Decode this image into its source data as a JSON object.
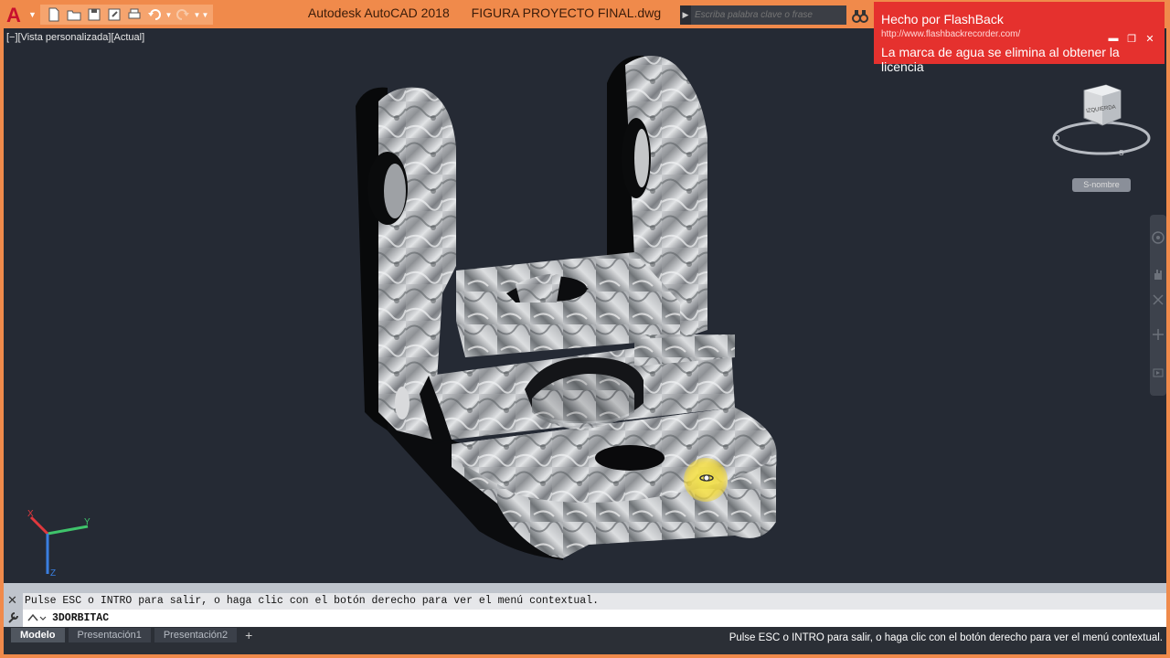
{
  "window": {
    "app_name": "Autodesk AutoCAD 2018",
    "file_name": "FIGURA PROYECTO FINAL.dwg"
  },
  "search": {
    "placeholder": "Escriba palabra clave o frase"
  },
  "watermark": {
    "title": "Hecho por FlashBack",
    "url": "http://www.flashbackrecorder.com/",
    "text": "La marca de agua se elimina al obtener la licencia"
  },
  "viewport": {
    "label": "[−][Vista personalizada][Actual]",
    "wcs_label": "S-nombre",
    "viewcube_face": "IZQUIERDA",
    "viewcube_compass": {
      "west": "O",
      "south": "S"
    },
    "ucs": {
      "x": "X",
      "y": "Y",
      "z": "Z"
    }
  },
  "command": {
    "history": "Pulse ESC o INTRO para salir, o haga clic con el botón derecho para ver el menú contextual.",
    "current": "3DORBITAC"
  },
  "layout_tabs": [
    {
      "label": "Modelo",
      "active": true
    },
    {
      "label": "Presentación1",
      "active": false
    },
    {
      "label": "Presentación2",
      "active": false
    }
  ],
  "status": {
    "message": "Pulse ESC o INTRO para salir, o haga clic con el botón derecho para ver el menú contextual."
  },
  "colors": {
    "titlebar": "#f08a4b",
    "viewport_bg": "#252a34",
    "watermark_bg": "#e5312e",
    "accent_red": "#c8102e",
    "cursor_highlight": "#f5dc3c"
  },
  "icons": [
    "autocad-logo-icon",
    "new-icon",
    "open-icon",
    "save-icon",
    "saveas-icon",
    "print-icon",
    "undo-icon",
    "redo-icon",
    "binoculars-icon",
    "help-icon",
    "orbit-cursor-icon",
    "wrench-icon"
  ]
}
